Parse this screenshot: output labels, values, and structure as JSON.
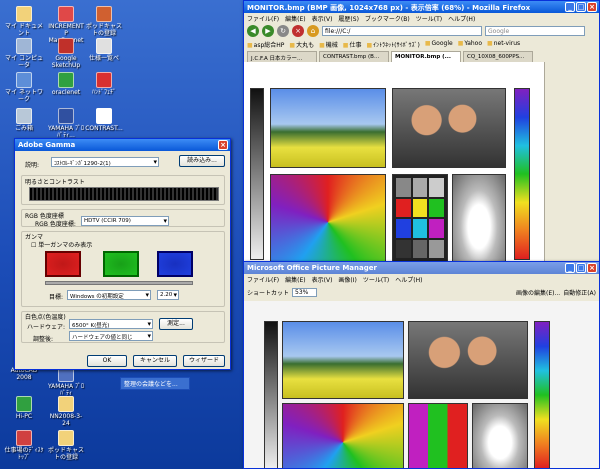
{
  "desktop": {
    "icons": [
      {
        "label": "マイ ドキュメント",
        "color": "#f2d27a"
      },
      {
        "label": "INCREMENT P MapFan.net",
        "color": "#e04848"
      },
      {
        "label": "ポッドキャストの登録",
        "color": "#d06030"
      },
      {
        "label": "マイ コンピュータ",
        "color": "#9fb6d6"
      },
      {
        "label": "Google SketchUp",
        "color": "#c0302a"
      },
      {
        "label": "仕様一覧ペ",
        "color": "#e0e0e0"
      },
      {
        "label": "マイ ネットワーク",
        "color": "#5d8ed8"
      },
      {
        "label": "oraclenet",
        "color": "#30a040"
      },
      {
        "label": "ﾊﾝﾄﾞﾌｪﾁﾞ",
        "color": "#d83030"
      },
      {
        "label": "ごみ箱",
        "color": "#b8c8d8"
      },
      {
        "label": "YAMAHA ﾌﾟﾛﾊﾟﾃｨ...",
        "color": "#3050a0"
      },
      {
        "label": "CONTRAST...",
        "color": "#ffffff"
      },
      {
        "label": "AutoCAD 2008",
        "color": "#c03020"
      },
      {
        "label": "YAMAHA ﾌﾟﾛﾊﾟﾃｨ",
        "color": "#5070c0"
      },
      {
        "label": "Hi-PC",
        "color": "#30a040"
      },
      {
        "label": "NN2008-3-24",
        "color": "#f2d27a"
      },
      {
        "label": "仕事場のﾃﾞｨｽｸﾄｯﾌﾟ",
        "color": "#d04040"
      },
      {
        "label": "ポッドキャストの登録",
        "color": "#f2d27a"
      }
    ]
  },
  "firefox": {
    "title": "MONITOR.bmp (BMP 画像, 1024x768 px) - 表示倍率 (68%) - Mozilla Firefox",
    "menu": [
      "ファイル(F)",
      "編集(E)",
      "表示(V)",
      "履歴(S)",
      "ブックマーク(B)",
      "ツール(T)",
      "ヘルプ(H)"
    ],
    "address": "file:///C:/",
    "search_placeholder": "Google",
    "bookmarks": [
      "asp総合HP",
      "大丸も",
      "機械",
      "仕事",
      "ｲﾝﾄﾗﾈｯﾄ(ｻｲﾎﾞｳｽﾞ)",
      "Google",
      "Yahoo",
      "net-virus"
    ],
    "tabs": [
      "J.C.F.A 日本カラー...",
      "CONTRAST.bmp (B...",
      "MONITOR.bmp (...",
      "CQ_10X08_600PPS..."
    ]
  },
  "gamma": {
    "title": "Adobe Gamma",
    "desc_label": "説明:",
    "desc_value": "ｺｽﾄﾛﾙ-ｷﾞﾝｶﾞ1290-2(1)",
    "load_button": "読み込み...",
    "brightness_label": "明るさとコントラスト",
    "phosphor_label": "RGB 色度座標",
    "phosphor_sub": "RGB 色度座標:",
    "phosphor_value": "HDTV (CCIR 709)",
    "gamma_label": "ガンマ",
    "single_gamma": "単一ガンマのみ表示",
    "desired_label": "目標:",
    "desired_value": "Windows の初期設定",
    "gamma_value": "2.20",
    "whitepoint_label": "白色点(色温度)",
    "hardware_label": "ハードウェア:",
    "hardware_value": "6500° K(昼光)",
    "measure_button": "測定...",
    "adjusted_label": "調整後:",
    "adjusted_value": "ハードウェアの値と同じ",
    "ok": "OK",
    "cancel": "キャンセル",
    "wizard": "ウィザード"
  },
  "office": {
    "title": "Microsoft Office Picture Manager",
    "menu": [
      "ファイル(F)",
      "編集(E)",
      "表示(V)",
      "画像(I)",
      "ツール(T)",
      "ヘルプ(H)"
    ],
    "shortcut": "ショートカット",
    "zoom": "53%",
    "edit_button": "画像の編集(E)...",
    "auto_button": "自動修正(A)"
  },
  "taskbar_item": "整理の会議などを...",
  "colors": {
    "title_blue": "#0a58d8",
    "rgb_red": "#e02020",
    "rgb_green": "#20c020",
    "rgb_blue": "#2040e0"
  }
}
